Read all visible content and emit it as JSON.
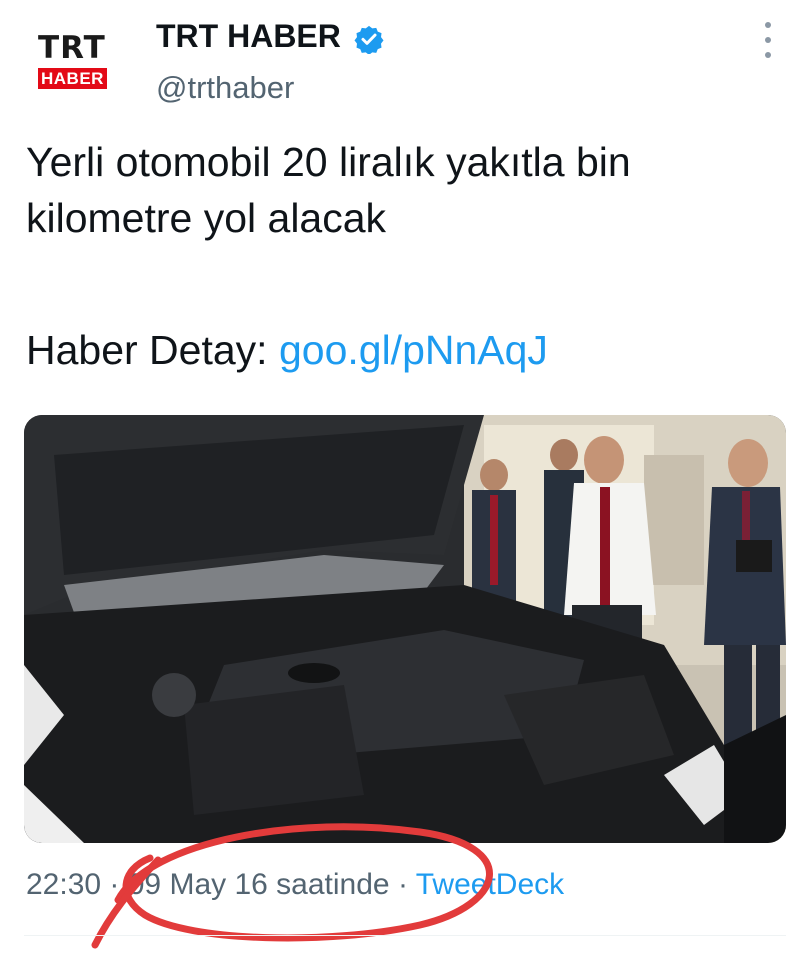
{
  "account": {
    "avatar_top": "TRT",
    "avatar_bottom": "HABER",
    "display_name": "TRT HABER",
    "handle": "@trthaber",
    "verified": true
  },
  "tweet": {
    "text": "Yerli otomobil 20 liralık yakıtla bin kilometre yol alacak",
    "detail_label": "Haber Detay:",
    "detail_link": "goo.gl/pNnAqJ"
  },
  "meta": {
    "time": "22:30",
    "date": "09 May 16 saatinde",
    "separator": "·",
    "source": "TweetDeck"
  },
  "colors": {
    "link": "#1d9bf0",
    "secondary_text": "#536471",
    "brand_red": "#e30a17",
    "annotation_red": "#e23b3b"
  },
  "icons": {
    "verified": "verified-badge-icon",
    "more": "more-options-icon"
  }
}
